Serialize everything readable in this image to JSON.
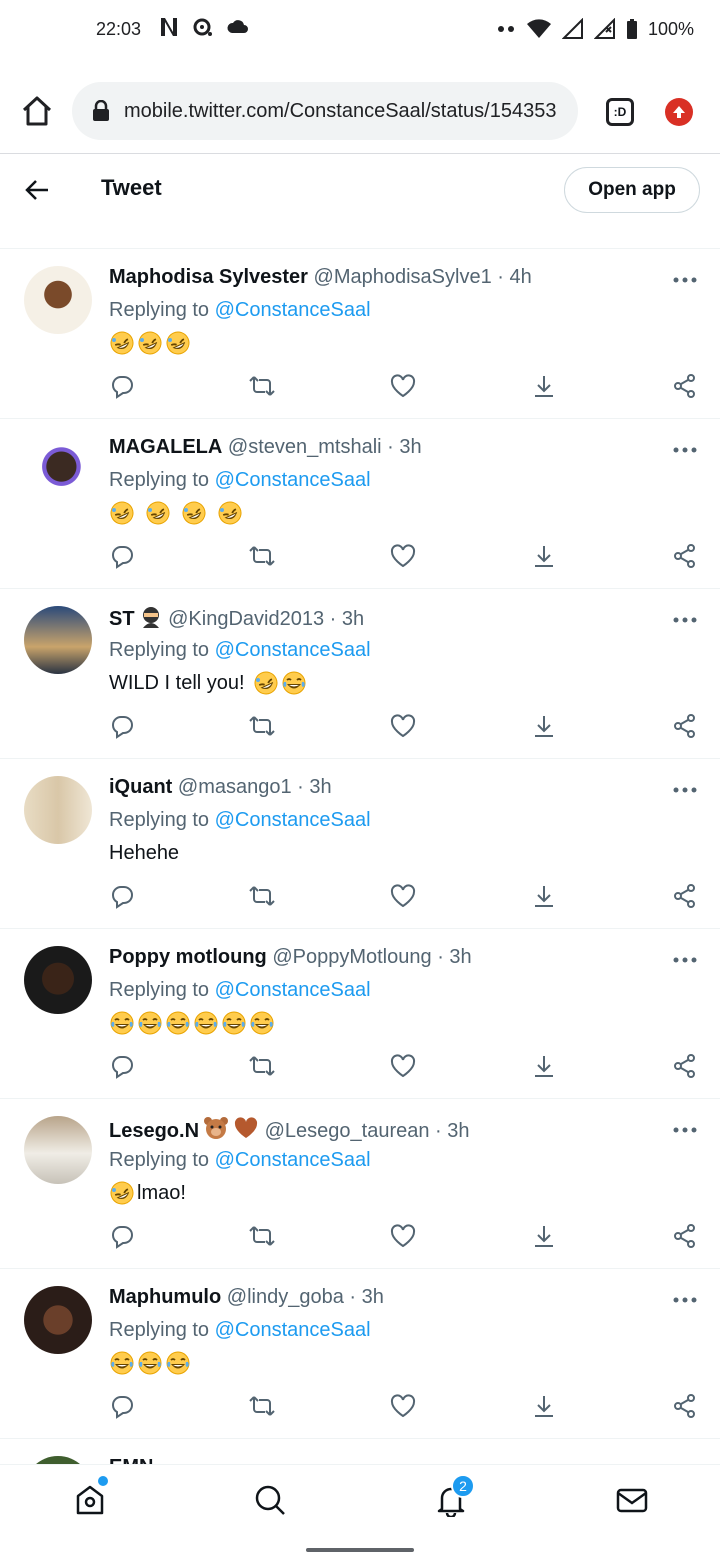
{
  "status_bar": {
    "time": "22:03",
    "battery": "100%"
  },
  "browser": {
    "url": "mobile.twitter.com/ConstanceSaal/status/154353",
    "tabs_label": ":D"
  },
  "header": {
    "title": "Tweet",
    "open_app": "Open app"
  },
  "tweets": [
    {
      "name": "Maphodisa Sylvester",
      "handle": "@MaphodisaSylve1",
      "sep": "·",
      "age": "4h",
      "replying_prefix": "Replying to",
      "replying_to": "@ConstanceSaal",
      "text": "",
      "emojis": [
        "rofl",
        "rofl",
        "rofl"
      ]
    },
    {
      "name": "MAGALELA",
      "handle": "@steven_mtshali",
      "sep": "·",
      "age": "3h",
      "replying_prefix": "Replying to",
      "replying_to": "@ConstanceSaal",
      "text": "",
      "emojis": [
        "rofl",
        "rofl",
        "rofl",
        "rofl"
      ]
    },
    {
      "name": "ST",
      "handle": "@KingDavid2013",
      "sep": "·",
      "age": "3h",
      "replying_prefix": "Replying to",
      "replying_to": "@ConstanceSaal",
      "text": "WILD I tell you!",
      "emojis": [
        "rofl",
        "joy"
      ]
    },
    {
      "name": "iQuant",
      "handle": "@masango1",
      "sep": "·",
      "age": "3h",
      "replying_prefix": "Replying to",
      "replying_to": "@ConstanceSaal",
      "text": "Hehehe",
      "emojis": []
    },
    {
      "name": "Poppy motloung",
      "handle": "@PoppyMotloung",
      "sep": "·",
      "age": "3h",
      "replying_prefix": "Replying to",
      "replying_to": "@ConstanceSaal",
      "text": "",
      "emojis": [
        "joy",
        "joy",
        "joy",
        "joy",
        "joy",
        "joy"
      ]
    },
    {
      "name": "Lesego.N",
      "handle": "@Lesego_taurean",
      "sep": "·",
      "age": "3h",
      "replying_prefix": "Replying to",
      "replying_to": "@ConstanceSaal",
      "text": "lmao!",
      "emojis": [
        "rofl"
      ]
    },
    {
      "name": "Maphumulo",
      "handle": "@lindy_goba",
      "sep": "·",
      "age": "3h",
      "replying_prefix": "Replying to",
      "replying_to": "@ConstanceSaal",
      "text": "",
      "emojis": [
        "joy",
        "joy",
        "joy"
      ]
    }
  ],
  "partial_tweet": {
    "name": "EMN"
  },
  "nav": {
    "notifications_badge": "2"
  },
  "colors": {
    "accent": "#1d9bf0",
    "text_primary": "#0f1419",
    "text_secondary": "#536471",
    "divider": "#eff3f4"
  }
}
